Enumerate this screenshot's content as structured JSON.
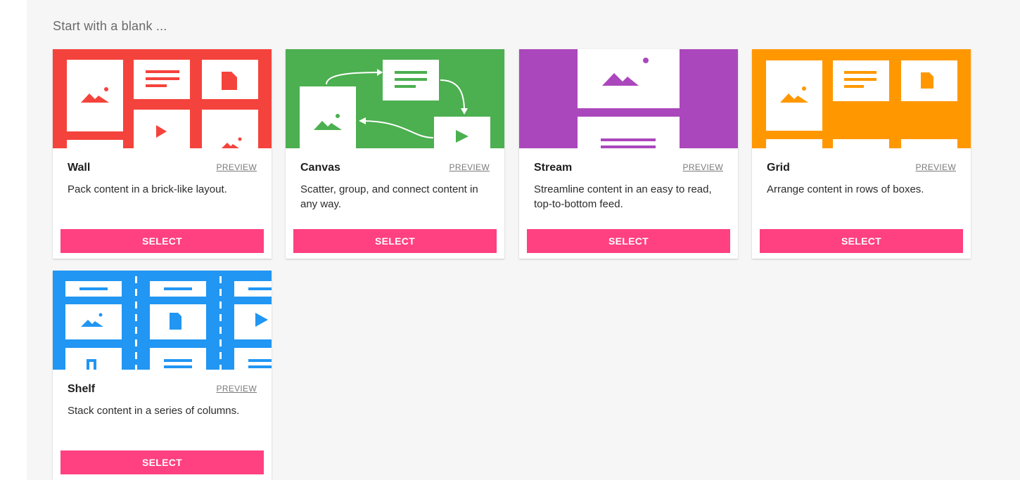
{
  "heading": "Start with a blank ...",
  "accent": "#ff4081",
  "cards": [
    {
      "title": "Wall",
      "preview": "PREVIEW",
      "description": "Pack content in a brick-like layout.",
      "select": "SELECT",
      "color": "#f4433c",
      "illustration": "wall-layout-icon"
    },
    {
      "title": "Canvas",
      "preview": "PREVIEW",
      "description": "Scatter, group, and connect content in any way.",
      "select": "SELECT",
      "color": "#4caf50",
      "illustration": "canvas-layout-icon"
    },
    {
      "title": "Stream",
      "preview": "PREVIEW",
      "description": "Streamline content in an easy to read, top-to-bottom feed.",
      "select": "SELECT",
      "color": "#ab47bc",
      "illustration": "stream-layout-icon"
    },
    {
      "title": "Grid",
      "preview": "PREVIEW",
      "description": "Arrange content in rows of boxes.",
      "select": "SELECT",
      "color": "#ff9800",
      "illustration": "grid-layout-icon"
    },
    {
      "title": "Shelf",
      "preview": "PREVIEW",
      "description": "Stack content in a series of columns.",
      "select": "SELECT",
      "color": "#2196f3",
      "illustration": "shelf-layout-icon"
    }
  ]
}
